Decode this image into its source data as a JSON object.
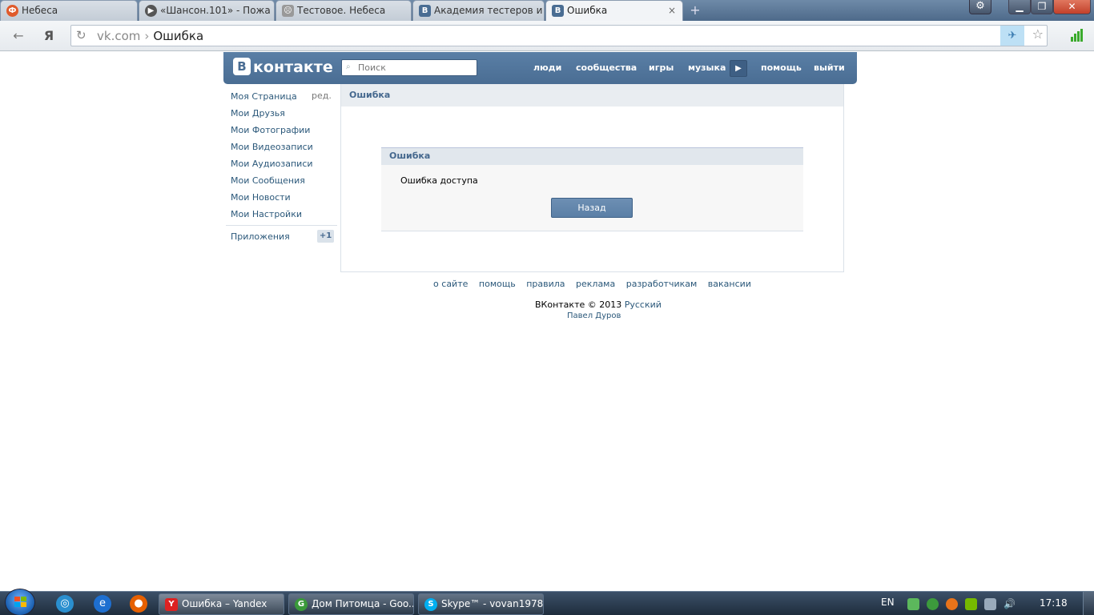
{
  "browser": {
    "tabs": [
      {
        "label": "Небеса",
        "icon": "Ф"
      },
      {
        "label": "«Шансон.101» - Пожа",
        "icon": "▶"
      },
      {
        "label": "Тестовое. Небеса",
        "icon": "☹"
      },
      {
        "label": "Академия тестеров и",
        "icon": "B"
      },
      {
        "label": "Ошибка",
        "icon": "B"
      }
    ],
    "yandex_logo": "Я",
    "address": {
      "domain": "vk.com",
      "separator": "›",
      "page": "Ошибка"
    },
    "colors": {
      "tabbar": "#4e6a8a",
      "accent": "#3a7bb0"
    }
  },
  "vk": {
    "logo_letter": "B",
    "logo_text": "контакте",
    "search_placeholder": "Поиск",
    "nav": [
      "люди",
      "сообщества",
      "игры",
      "музыка",
      "помощь",
      "выйти"
    ],
    "left_menu": {
      "edit": "ред.",
      "items": [
        "Моя Страница",
        "Мои Друзья",
        "Мои Фотографии",
        "Мои Видеозаписи",
        "Мои Аудиозаписи",
        "Мои Сообщения",
        "Мои Новости",
        "Мои Настройки"
      ],
      "apps": "Приложения",
      "apps_badge": "+1"
    },
    "content": {
      "header": "Ошибка",
      "box_title": "Ошибка",
      "message": "Ошибка доступа",
      "back_button": "Назад"
    },
    "footer": {
      "links": [
        "о сайте",
        "помощь",
        "правила",
        "реклама",
        "разработчикам",
        "вакансии"
      ],
      "copyright": "ВКонтакте © 2013",
      "language": "Русский",
      "author": "Павел Дуров"
    },
    "colors": {
      "header": "#4a6d93",
      "link": "#2b587a",
      "title": "#45688e"
    }
  },
  "taskbar": {
    "windows": [
      {
        "label": "Ошибка – Yandex",
        "icon": "Y"
      },
      {
        "label": "Дом Питомца - Goo...",
        "icon": "G"
      },
      {
        "label": "Skype™ - vovan1978....",
        "icon": "S"
      }
    ],
    "language": "EN",
    "clock": "17:18"
  }
}
